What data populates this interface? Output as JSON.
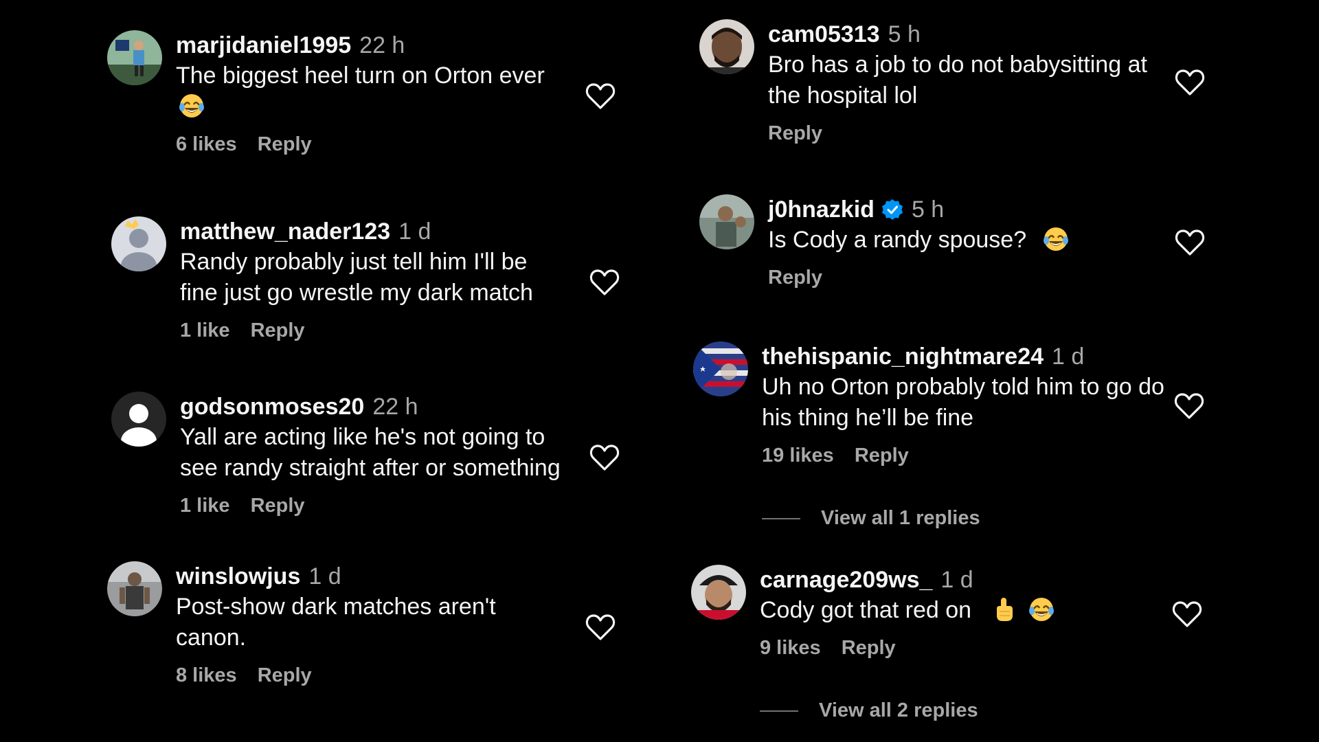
{
  "colors": {
    "background": "#000000",
    "primary_text": "#f5f5f5",
    "secondary_text": "#a8a8a8",
    "verified_blue": "#0095f6"
  },
  "left_column": [
    {
      "username": "marjidaniel1995",
      "time": "22 h",
      "text": "The biggest heel turn on Orton ever",
      "emoji": [
        "laughing-tears-emoji"
      ],
      "likes": "6 likes",
      "reply": "Reply"
    },
    {
      "username": "matthew_nader123",
      "time": "1 d",
      "text": "Randy probably just tell him I'll be fine just go wrestle my dark match",
      "likes": "1 like",
      "reply": "Reply"
    },
    {
      "username": "godsonmoses20",
      "time": "22 h",
      "text": "Yall are acting like he's not going to see randy straight after or something",
      "likes": "1 like",
      "reply": "Reply"
    },
    {
      "username": "winslowjus",
      "time": "1 d",
      "text": "Post-show dark matches aren't canon.",
      "likes": "8 likes",
      "reply": "Reply"
    }
  ],
  "right_column": [
    {
      "username": "cam05313",
      "time": "5 h",
      "text": "Bro has a job to do not babysitting at the hospital lol",
      "reply": "Reply"
    },
    {
      "username": "j0hnazkid",
      "verified": true,
      "time": "5 h",
      "text": "Is Cody a randy spouse?",
      "emoji": [
        "laughing-tears-emoji"
      ],
      "reply": "Reply"
    },
    {
      "username": "thehispanic_nightmare24",
      "time": "1 d",
      "text": "Uh no Orton probably told him to go do his thing he’ll be fine",
      "likes": "19 likes",
      "reply": "Reply",
      "view_replies": "View all 1 replies"
    },
    {
      "username": "carnage209ws_",
      "time": "1 d",
      "text": "Cody got that red on",
      "emoji": [
        "pointing-up-emoji",
        "laughing-tears-emoji"
      ],
      "likes": "9 likes",
      "reply": "Reply",
      "view_replies": "View all 2 replies"
    }
  ]
}
